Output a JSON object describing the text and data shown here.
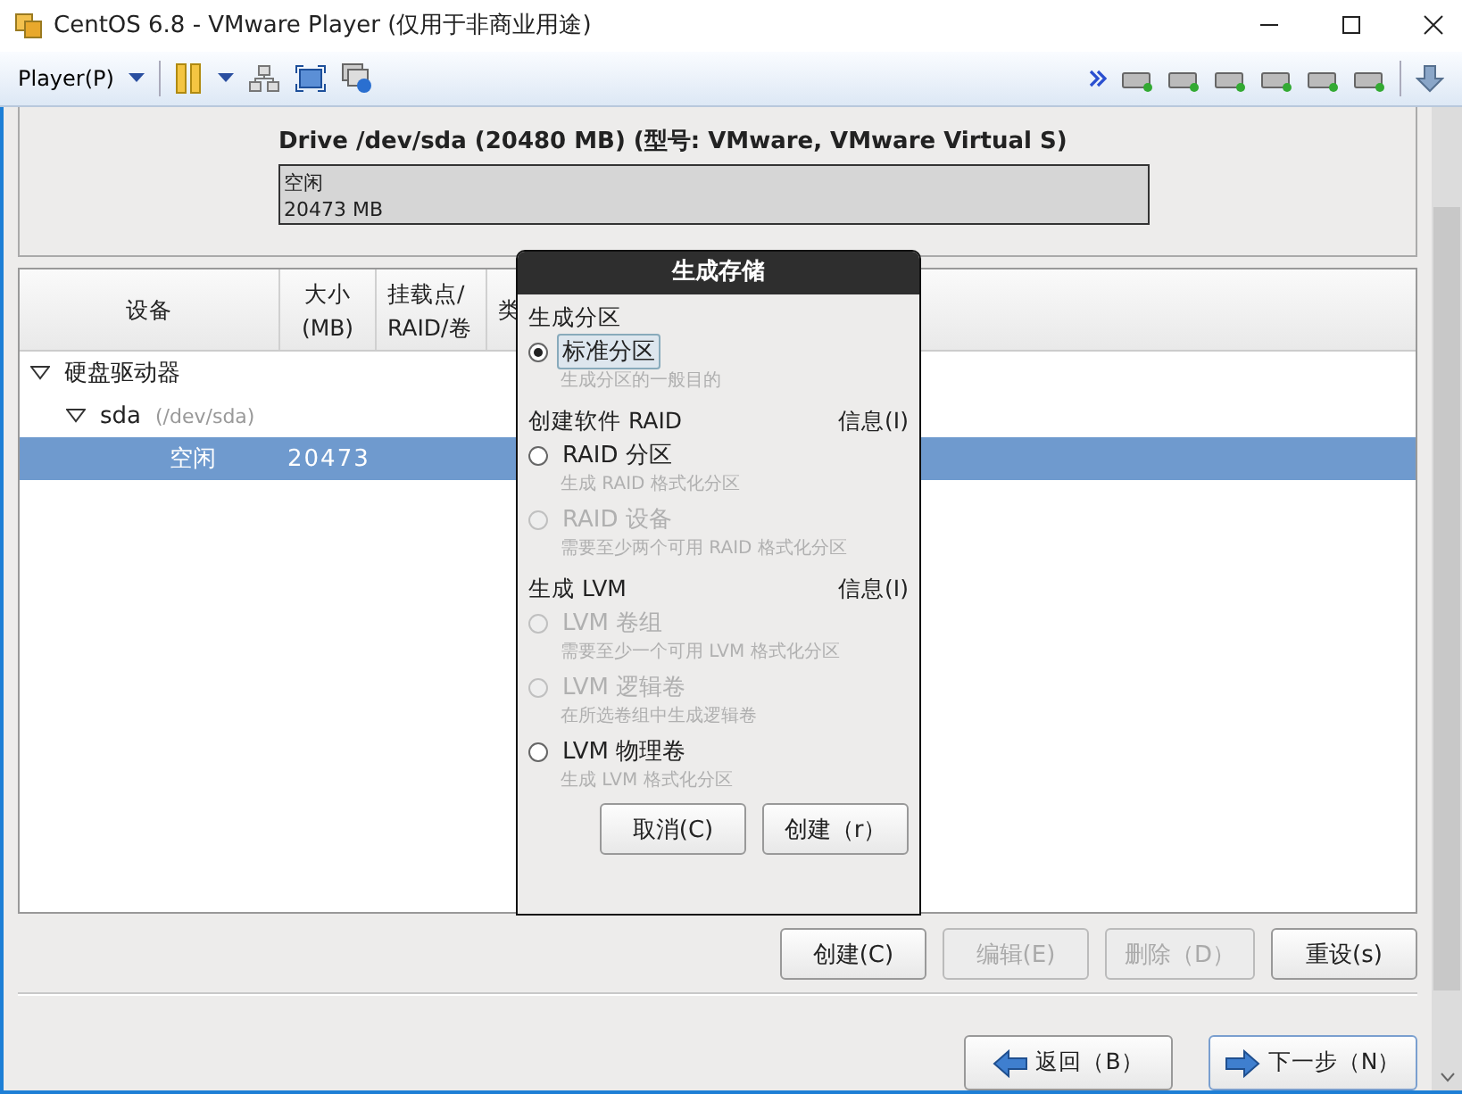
{
  "window": {
    "title": "CentOS 6.8 - VMware Player (仅用于非商业用途)"
  },
  "toolbar": {
    "menu": "Player(P)"
  },
  "drive": {
    "title": "Drive /dev/sda (20480 MB) (型号: VMware, VMware Virtual S)",
    "segment": {
      "label": "空闲",
      "size": "20473 MB"
    }
  },
  "table": {
    "columns": [
      {
        "lines": [
          "设备"
        ]
      },
      {
        "lines": [
          "大小",
          "(MB)"
        ]
      },
      {
        "lines": [
          "挂载点/",
          "RAID/卷"
        ]
      },
      {
        "lines": [
          "类"
        ]
      }
    ],
    "rows": [
      {
        "device": "硬盘驱动器",
        "expanded": true,
        "selected": false,
        "children": [
          {
            "device": "sda",
            "path": "(/dev/sda)",
            "expanded": true,
            "selected": false,
            "children": [
              {
                "device": "空闲",
                "size": "20473",
                "selected": true
              }
            ]
          }
        ]
      }
    ]
  },
  "actions": [
    {
      "label": "创建(C)",
      "disabled": false
    },
    {
      "label": "编辑(E)",
      "disabled": true
    },
    {
      "label": "删除（D）",
      "disabled": true
    },
    {
      "label": "重设(s)",
      "disabled": false
    }
  ],
  "nav": [
    {
      "label": "返回（B）",
      "kind": "back"
    },
    {
      "label": "下一步（N）",
      "kind": "next"
    }
  ],
  "dialog": {
    "title": "生成存储",
    "sections": [
      {
        "heading": "生成分区",
        "options": [
          {
            "label": "标准分区",
            "description": "生成分区的一般目的",
            "selected": true,
            "disabled": false
          }
        ]
      },
      {
        "heading": "创建软件 RAID",
        "info": "信息(I)",
        "options": [
          {
            "label": "RAID 分区",
            "description": "生成 RAID 格式化分区",
            "selected": false,
            "disabled": false
          },
          {
            "label": "RAID 设备",
            "description": "需要至少两个可用 RAID 格式化分区",
            "selected": false,
            "disabled": true
          }
        ]
      },
      {
        "heading": "生成 LVM",
        "info": "信息(I)",
        "options": [
          {
            "label": "LVM 卷组",
            "description": "需要至少一个可用 LVM 格式化分区",
            "selected": false,
            "disabled": true
          },
          {
            "label": "LVM 逻辑卷",
            "description": "在所选卷组中生成逻辑卷",
            "selected": false,
            "disabled": true
          },
          {
            "label": "LVM 物理卷",
            "description": "生成 LVM 格式化分区",
            "selected": false,
            "disabled": false
          }
        ]
      }
    ],
    "buttons": [
      "取消(C)",
      "创建（r）"
    ]
  }
}
